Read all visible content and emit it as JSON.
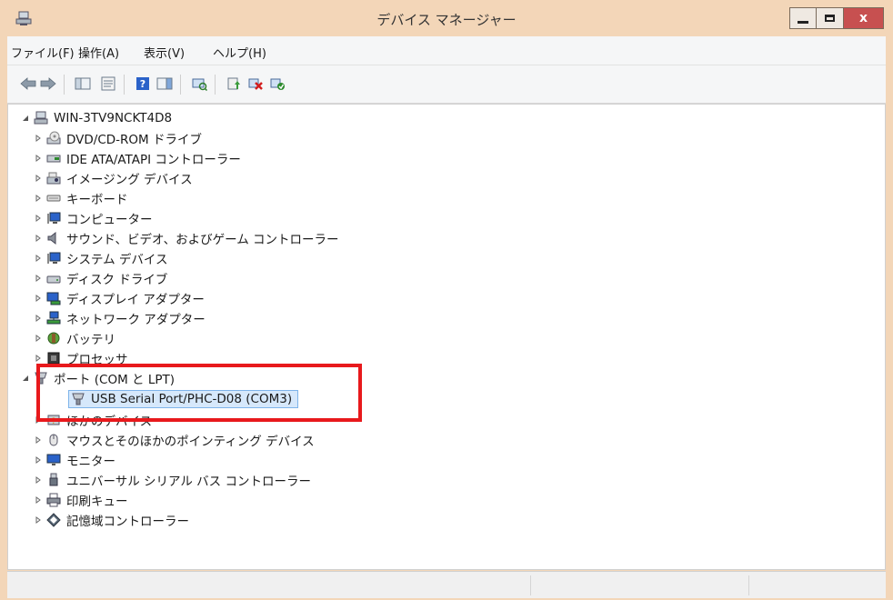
{
  "window": {
    "title": "デバイス マネージャー",
    "close_label": "x"
  },
  "menu": [
    {
      "label": "ファイル(F)"
    },
    {
      "label": "操作(A)"
    },
    {
      "label": "表示(V)"
    },
    {
      "label": "ヘルプ(H)"
    }
  ],
  "toolbar": [
    {
      "icon": "back-arrow-icon"
    },
    {
      "icon": "forward-arrow-icon"
    },
    {
      "icon": "show-hide-console-tree-icon"
    },
    {
      "icon": "properties-icon"
    },
    {
      "icon": "help-icon"
    },
    {
      "icon": "action-pane-icon"
    },
    {
      "icon": "scan-hardware-changes-icon"
    },
    {
      "icon": "update-driver-icon"
    },
    {
      "icon": "uninstall-device-icon"
    },
    {
      "icon": "enable-device-icon"
    }
  ],
  "tree": {
    "root": "WIN-3TV9NCKT4D8",
    "categories": [
      "DVD/CD-ROM ドライブ",
      "IDE ATA/ATAPI コントローラー",
      "イメージング デバイス",
      "キーボード",
      "コンピューター",
      "サウンド、ビデオ、およびゲーム コントローラー",
      "システム デバイス",
      "ディスク ドライブ",
      "ディスプレイ アダプター",
      "ネットワーク アダプター",
      "バッテリ",
      "プロセッサ",
      "ポート (COM と LPT)",
      "ほかのデバイス",
      "マウスとそのほかのポインティング デバイス",
      "モニター",
      "ユニバーサル シリアル バス コントローラー",
      "印刷キュー",
      "記憶域コントローラー"
    ],
    "selected_device": "USB Serial Port/PHC-D08 (COM3)"
  },
  "colors": {
    "title_bg": "#f3d6b8",
    "close_bg": "#c75050",
    "highlight": "#e8191c",
    "selection_bg": "#d6e8fb"
  }
}
